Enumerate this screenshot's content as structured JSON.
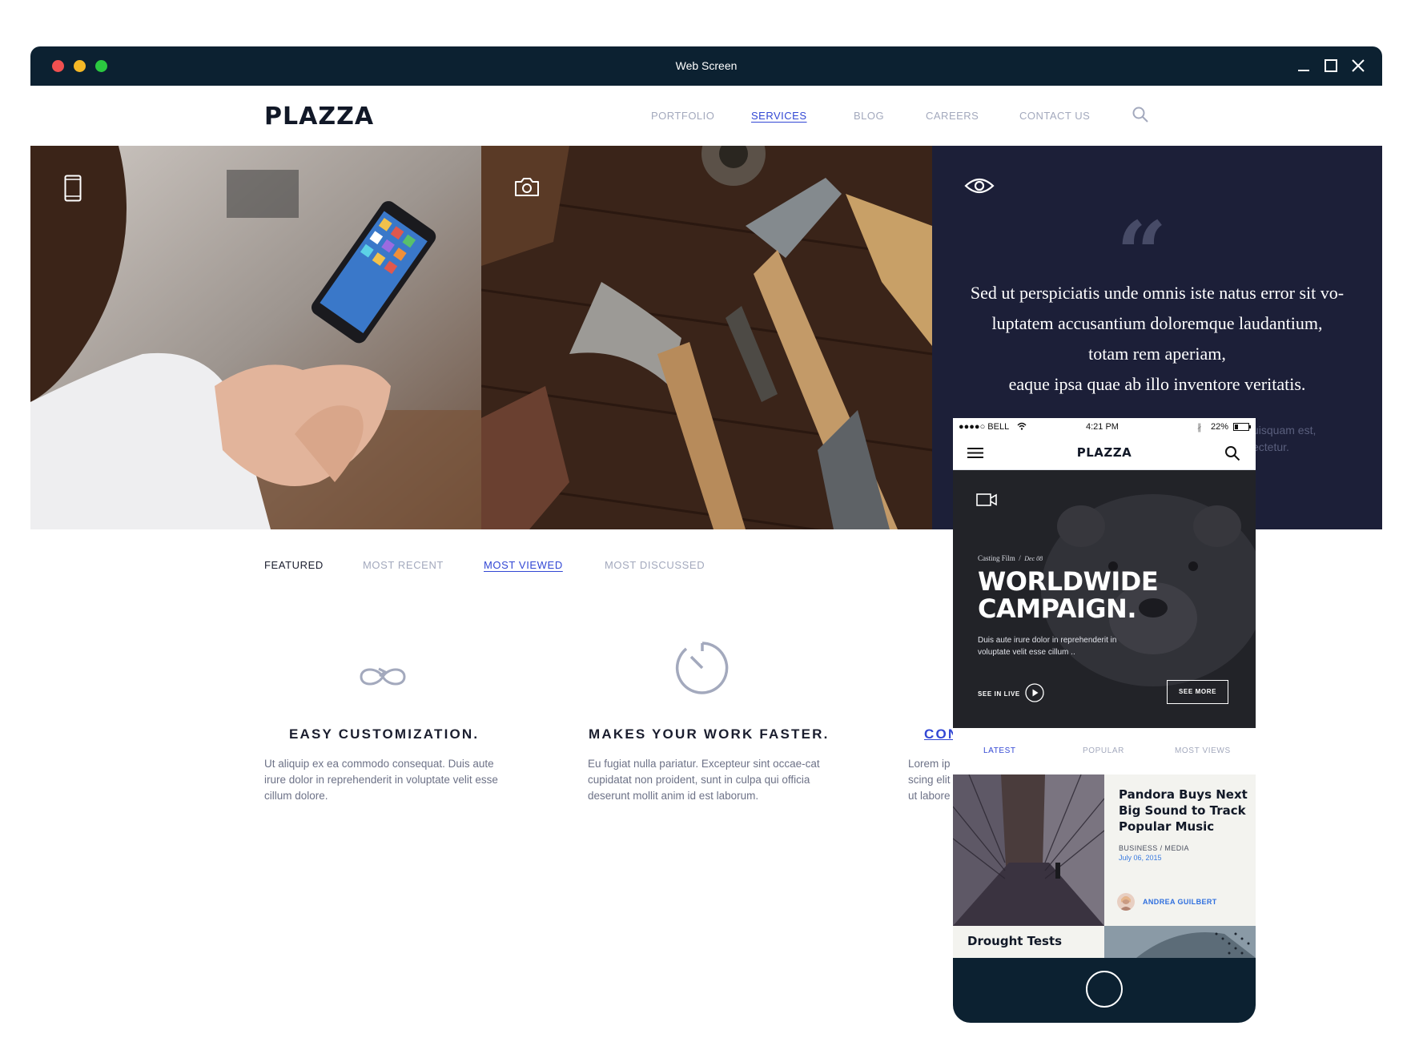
{
  "window": {
    "title": "Web Screen"
  },
  "site": {
    "logo": "PLAZZA",
    "nav": [
      "PORTFOLIO",
      "SERVICES",
      "BLOG",
      "CAREERS",
      "CONTACT US"
    ],
    "active_nav": "SERVICES"
  },
  "hero": {
    "quote_lines": [
      "Sed ut perspiciatis unde omnis iste natus error sit vo-",
      "luptatem accusantium doloremque laudantium,",
      "totam rem aperiam,",
      "eaque ipsa quae ab illo inventore veritatis."
    ],
    "quote_sub_lines": [
      "uisquam est,",
      "ectetur."
    ]
  },
  "filters": [
    "FEATURED",
    "MOST RECENT",
    "MOST VIEWED",
    "MOST DISCUSSED"
  ],
  "features": [
    {
      "title": "EASY CUSTOMIZATION.",
      "text": "Ut aliquip ex ea commodo consequat. Duis aute irure dolor in reprehenderit in voluptate velit esse cillum dolore.",
      "icon": "infinity-icon"
    },
    {
      "title": "MAKES YOUR WORK FASTER.",
      "text": "Eu fugiat nulla pariatur. Excepteur sint occae-cat cupidatat non proident, sunt in culpa qui officia deserunt mollit anim id est laborum.",
      "icon": "timer-icon"
    },
    {
      "title": "CON",
      "text_lines": [
        "Lorem ip",
        "scing elit",
        "ut labore"
      ]
    }
  ],
  "phone": {
    "status": {
      "carrier": "●●●●○ BELL",
      "time": "4:21 PM",
      "battery": "22%"
    },
    "logo": "PLAZZA",
    "hero": {
      "category": "Casting Film",
      "date": "Dec 08",
      "title_lines": [
        "WORLDWIDE",
        "CAMPAIGN."
      ],
      "desc": "Duis aute irure dolor in reprehenderit in voluptate velit esse cillum ..",
      "live": "SEE IN LIVE",
      "more": "SEE MORE"
    },
    "tabs": [
      "LATEST",
      "POPULAR",
      "MOST VIEWS"
    ],
    "card": {
      "title": "Pandora Buys Next Big Sound to Track Popular Music",
      "category": "BUSINESS / MEDIA",
      "date": "July 06, 2015",
      "author": "ANDREA GUILBERT"
    },
    "card2_title": "Drought Tests"
  },
  "colors": {
    "titlebar": "#0c2131",
    "accent": "#3247d4",
    "quote_panel": "#1c1f38",
    "muted": "#a3a9bd"
  }
}
